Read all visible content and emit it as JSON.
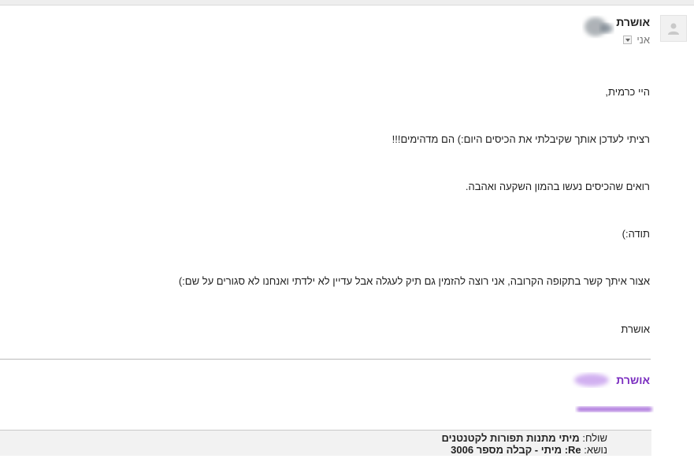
{
  "header": {
    "sender_name": "אושרת",
    "recipient": "אני"
  },
  "icons": {
    "profile": "person-placeholder-icon",
    "details": "chevron-down-icon"
  },
  "message": {
    "greeting": "היי כרמית,",
    "line1": "רציתי לעדכן אותך שקיבלתי את הכיסים היום:) הם מדהימים!!!",
    "line2": "רואים שהכיסים נעשו בהמון השקעה ואהבה.",
    "line3": "תודה:)",
    "line4": "אצור איתך קשר בתקופה הקרובה, אני רוצה להזמין גם תיק לעגלה אבל עדיין לא ילדתי ואנחנו לא סגורים על שם:)",
    "closing": "אושרת"
  },
  "signature": {
    "name": "אושרת"
  },
  "quoted": {
    "from_label": "שולח:",
    "from_value": "מיתי מתנות תפורות לקטנטנים",
    "subject_label": "נושא:",
    "subject_value": "Re: מיתי - קבלה מספר 3006"
  },
  "colors": {
    "signature_accent": "#7b2ec0"
  }
}
